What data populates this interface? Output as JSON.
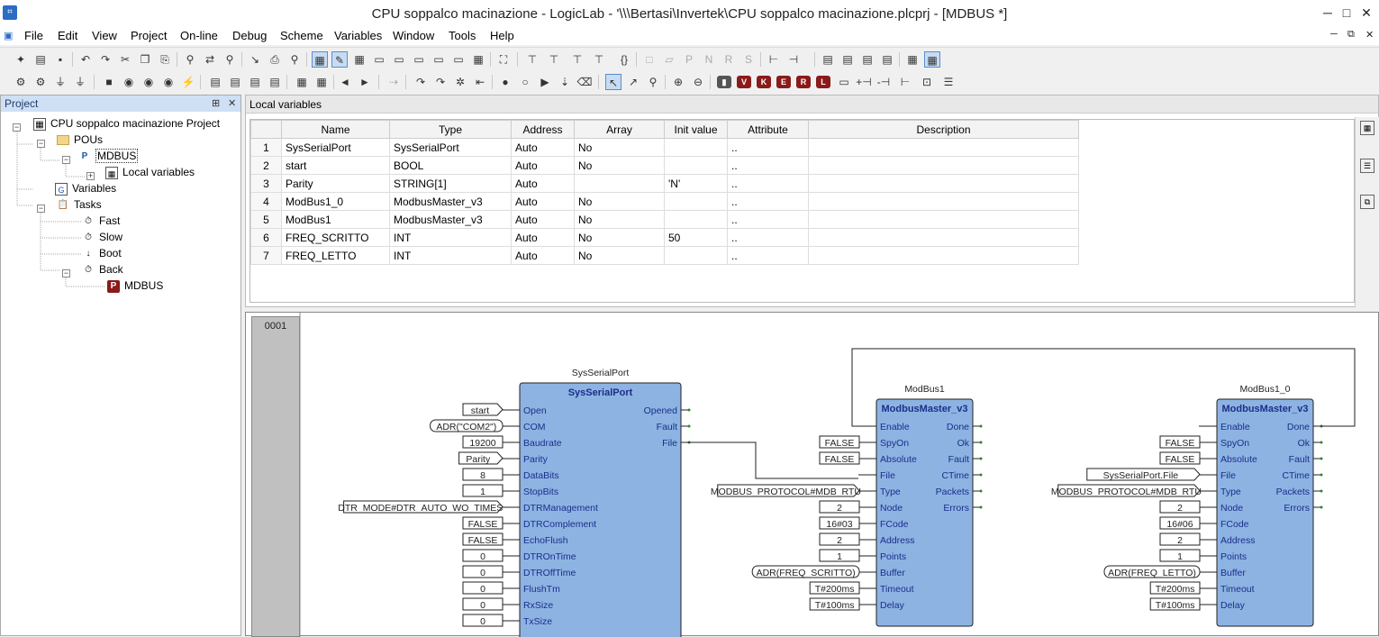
{
  "window": {
    "title": "CPU soppalco macinazione - LogicLab - '\\\\\\Bertasi\\Invertek\\CPU soppalco macinazione.plcprj - [MDBUS *]",
    "minimize": "─",
    "maximize": "□",
    "close": "✕"
  },
  "menu": {
    "items": [
      "File",
      "Edit",
      "View",
      "Project",
      "On-line",
      "Debug",
      "Scheme",
      "Variables",
      "Window",
      "Tools",
      "Help"
    ],
    "mdi_controls": [
      "─",
      "⧉",
      "✕"
    ]
  },
  "project_panel": {
    "title": "Project",
    "pin": "⊞",
    "close": "✕",
    "tree": {
      "root": "CPU soppalco macinazione Project",
      "pous": "POUs",
      "mdbus": "MDBUS",
      "local_variables": "Local variables",
      "variables": "Variables",
      "tasks": "Tasks",
      "fast": "Fast",
      "slow": "Slow",
      "boot": "Boot",
      "back": "Back",
      "back_mdbus": "MDBUS"
    }
  },
  "local_vars": {
    "title": "Local variables",
    "columns": [
      "",
      "Name",
      "Type",
      "Address",
      "Array",
      "Init value",
      "Attribute",
      "Description"
    ],
    "rows": [
      [
        "1",
        "SysSerialPort",
        "SysSerialPort",
        "Auto",
        "No",
        "",
        "..",
        ""
      ],
      [
        "2",
        "start",
        "BOOL",
        "Auto",
        "No",
        "",
        "..",
        ""
      ],
      [
        "3",
        "Parity",
        "STRING[1]",
        "Auto",
        "",
        "'N'",
        "..",
        ""
      ],
      [
        "4",
        "ModBus1_0",
        "ModbusMaster_v3",
        "Auto",
        "No",
        "",
        "..",
        ""
      ],
      [
        "5",
        "ModBus1",
        "ModbusMaster_v3",
        "Auto",
        "No",
        "",
        "..",
        ""
      ],
      [
        "6",
        "FREQ_SCRITTO",
        "INT",
        "Auto",
        "No",
        "50",
        "..",
        ""
      ],
      [
        "7",
        "FREQ_LETTO",
        "INT",
        "Auto",
        "No",
        "",
        "..",
        ""
      ]
    ]
  },
  "diagram": {
    "rung_number": "0001",
    "block_fill": "#8db3e2",
    "blocks": [
      {
        "instance": "SysSerialPort",
        "type": "SysSerialPort",
        "inputs": [
          "Open",
          "COM",
          "Baudrate",
          "Parity",
          "DataBits",
          "StopBits",
          "DTRManagement",
          "DTRComplement",
          "EchoFlush",
          "DTROnTime",
          "DTROffTime",
          "FlushTm",
          "RxSize",
          "TxSize"
        ],
        "outputs": [
          "Opened",
          "Fault",
          "File"
        ],
        "input_values": [
          "start",
          "ADR(\"COM2\")",
          "19200",
          "Parity",
          "8",
          "1",
          "DTR_MODE#DTR_AUTO_WO_TIMES",
          "FALSE",
          "FALSE",
          "0",
          "0",
          "0",
          "0",
          "0"
        ]
      },
      {
        "instance": "ModBus1",
        "type": "ModbusMaster_v3",
        "inputs": [
          "Enable",
          "SpyOn",
          "Absolute",
          "File",
          "Type",
          "Node",
          "FCode",
          "Address",
          "Points",
          "Buffer",
          "Timeout",
          "Delay"
        ],
        "outputs": [
          "Done",
          "Ok",
          "Fault",
          "CTime",
          "Packets",
          "Errors"
        ],
        "input_values": [
          "",
          "FALSE",
          "FALSE",
          "",
          "MODBUS_PROTOCOL#MDB_RTU",
          "2",
          "16#03",
          "2",
          "1",
          "ADR(FREQ_SCRITTO)",
          "T#200ms",
          "T#100ms"
        ]
      },
      {
        "instance": "ModBus1_0",
        "type": "ModbusMaster_v3",
        "inputs": [
          "Enable",
          "SpyOn",
          "Absolute",
          "File",
          "Type",
          "Node",
          "FCode",
          "Address",
          "Points",
          "Buffer",
          "Timeout",
          "Delay"
        ],
        "outputs": [
          "Done",
          "Ok",
          "Fault",
          "CTime",
          "Packets",
          "Errors"
        ],
        "input_values": [
          "",
          "FALSE",
          "FALSE",
          "SysSerialPort.File",
          "MODBUS_PROTOCOL#MDB_RTU",
          "2",
          "16#06",
          "2",
          "1",
          "ADR(FREQ_LETTO)",
          "T#200ms",
          "T#100ms"
        ]
      }
    ]
  }
}
